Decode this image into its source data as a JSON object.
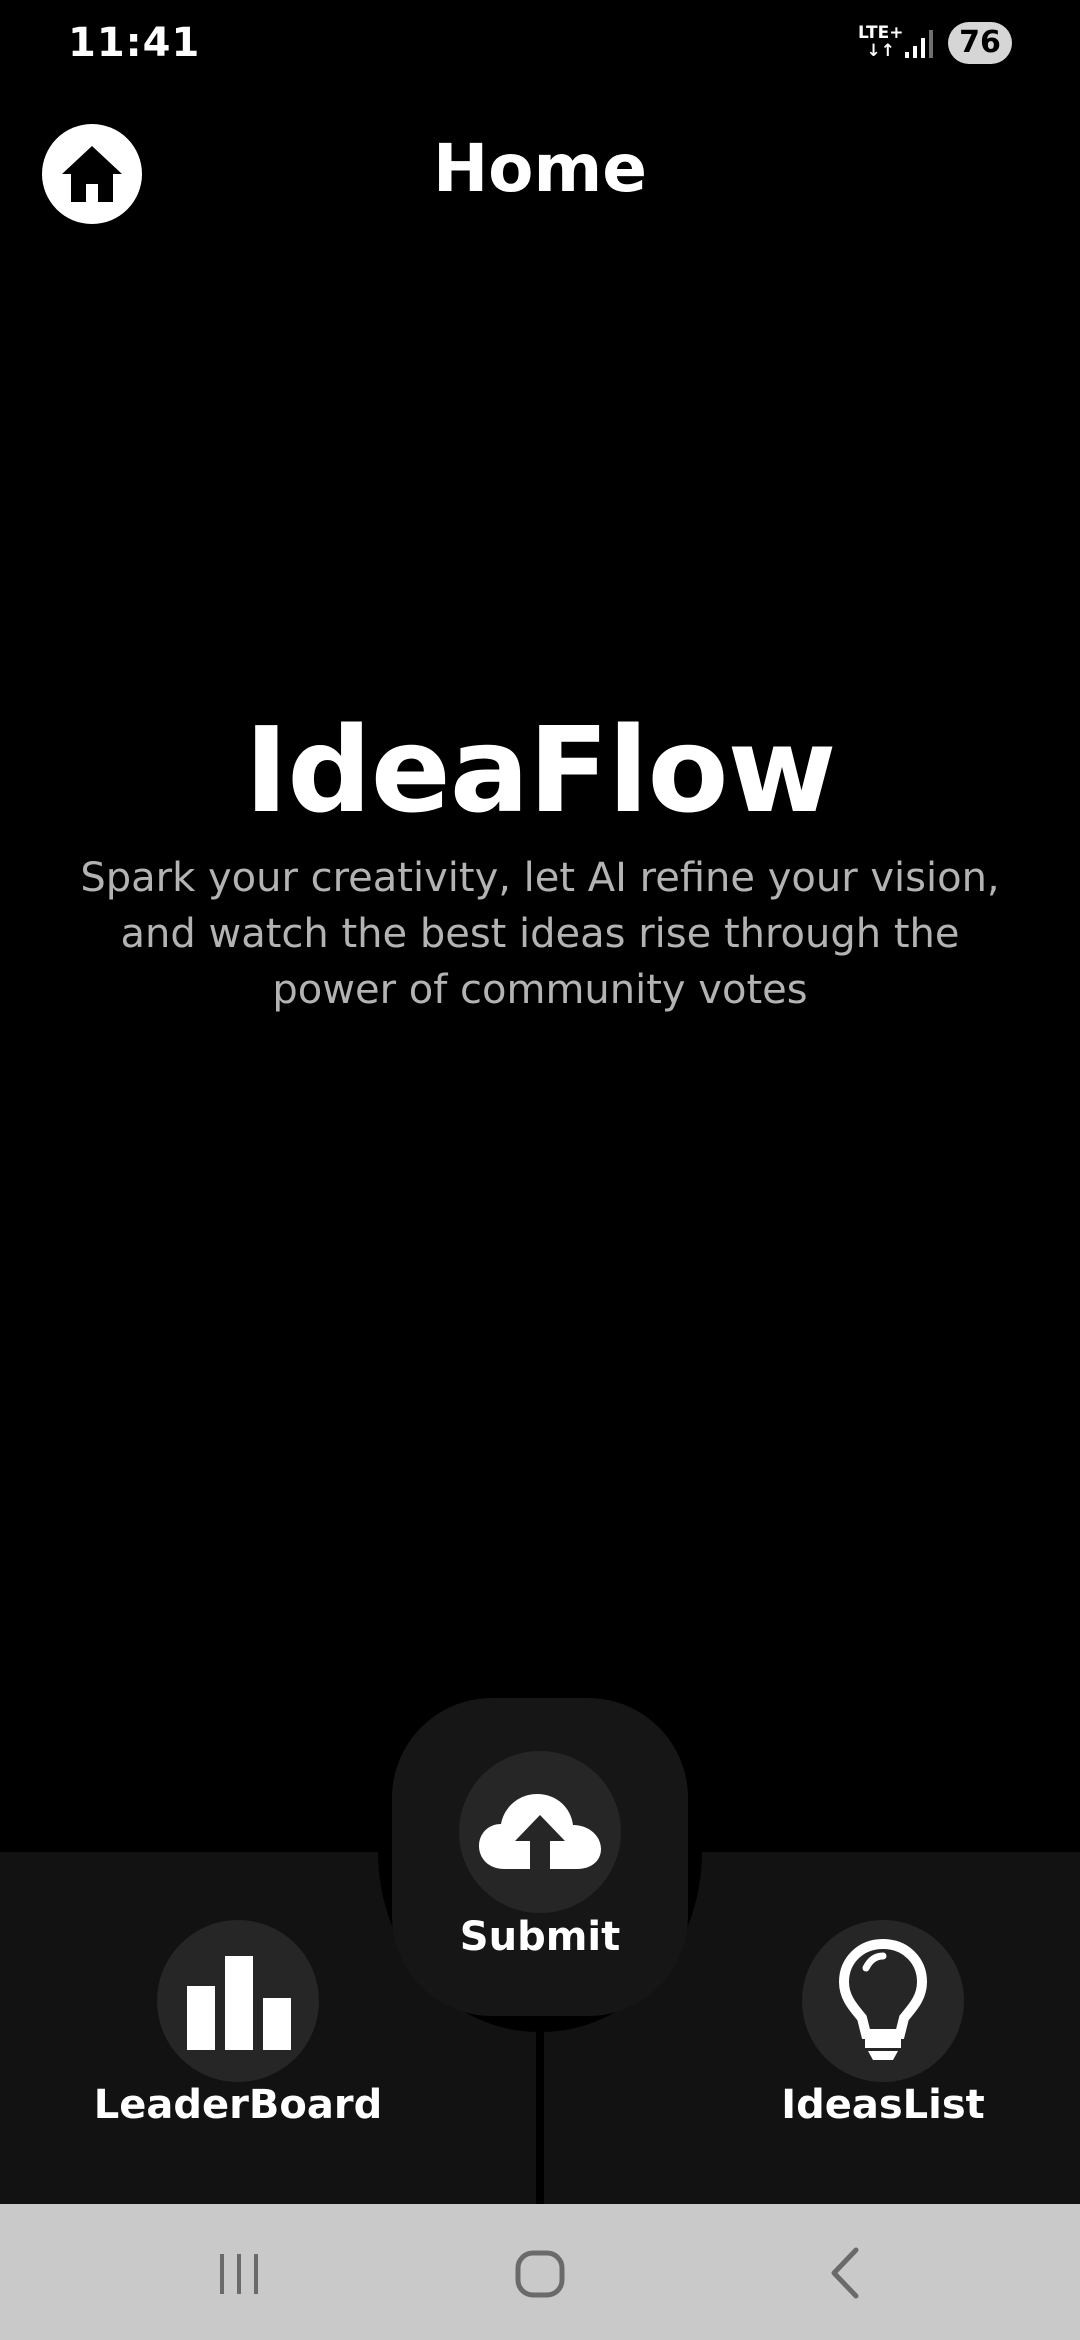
{
  "status_bar": {
    "time": "11:41",
    "network_top": "LTE+",
    "network_bottom": "↓↑",
    "battery": "76"
  },
  "header": {
    "title": "Home",
    "home_icon": "home-icon"
  },
  "hero": {
    "app_name": "IdeaFlow",
    "tagline": "Spark your creativity, let AI refine your vision, and watch the best ideas rise through the power of community votes"
  },
  "bottom_nav": {
    "items": [
      {
        "label": "LeaderBoard",
        "icon": "bar-chart-icon"
      },
      {
        "label": "Submit",
        "icon": "cloud-upload-icon"
      },
      {
        "label": "IdeasList",
        "icon": "lightbulb-icon"
      }
    ]
  },
  "system_nav": {
    "buttons": [
      "recent-apps-icon",
      "home-circle-icon",
      "back-icon"
    ]
  },
  "colors": {
    "background": "#000000",
    "nav_background": "#121212",
    "button_circle": "#262626",
    "tagline": "#b3b3b3",
    "system_nav": "#c9c9c9"
  }
}
